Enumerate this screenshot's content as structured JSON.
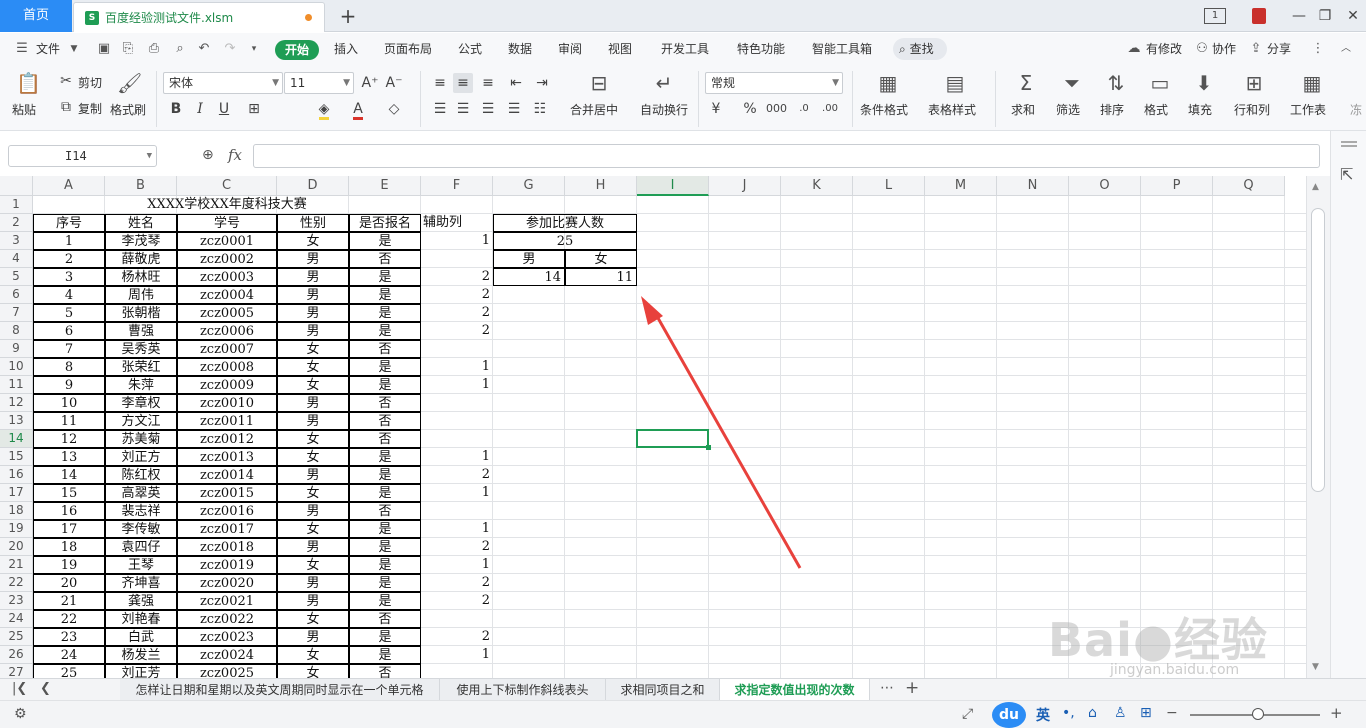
{
  "tabs": {
    "home": "首页",
    "file": "百度经验测试文件.xlsm",
    "new_tab": "+"
  },
  "window": {
    "badge": "1"
  },
  "menu": {
    "file": "文件",
    "items": [
      "开始",
      "插入",
      "页面布局",
      "公式",
      "数据",
      "审阅",
      "视图",
      "开发工具",
      "特色功能",
      "智能工具箱"
    ],
    "search": "查找",
    "right": [
      "有修改",
      "协作",
      "分享"
    ]
  },
  "ribbon": {
    "paste": "粘贴",
    "cut": "剪切",
    "copy": "复制",
    "format_painter": "格式刷",
    "font_name": "宋体",
    "font_size": "11",
    "merge_center": "合并居中",
    "wrap_text": "自动换行",
    "number_format": "常规",
    "conditional_format": "条件格式",
    "table_style": "表格样式",
    "sum": "求和",
    "filter": "筛选",
    "sort": "排序",
    "format": "格式",
    "fill": "填充",
    "rows_cols": "行和列",
    "worksheet": "工作表",
    "freeze": "冻"
  },
  "formula_bar": {
    "name_box": "I14",
    "fx": "fx",
    "value": ""
  },
  "sheet": {
    "columns": [
      "A",
      "B",
      "C",
      "D",
      "E",
      "F",
      "G",
      "H",
      "I",
      "J",
      "K",
      "L",
      "M",
      "N",
      "O",
      "P",
      "Q"
    ],
    "selected_col": "I",
    "selected_row": 14,
    "title": "XXXX学校XX年度科技大赛",
    "headers": [
      "序号",
      "姓名",
      "学号",
      "性别",
      "是否报名",
      "辅助列"
    ],
    "rows": [
      [
        "1",
        "李茂琴",
        "zcz0001",
        "女",
        "是",
        "1"
      ],
      [
        "2",
        "薛敬虎",
        "zcz0002",
        "男",
        "否",
        ""
      ],
      [
        "3",
        "杨林旺",
        "zcz0003",
        "男",
        "是",
        "2"
      ],
      [
        "4",
        "周伟",
        "zcz0004",
        "男",
        "是",
        "2"
      ],
      [
        "5",
        "张朝楷",
        "zcz0005",
        "男",
        "是",
        "2"
      ],
      [
        "6",
        "曹强",
        "zcz0006",
        "男",
        "是",
        "2"
      ],
      [
        "7",
        "吴秀英",
        "zcz0007",
        "女",
        "否",
        ""
      ],
      [
        "8",
        "张荣红",
        "zcz0008",
        "女",
        "是",
        "1"
      ],
      [
        "9",
        "朱萍",
        "zcz0009",
        "女",
        "是",
        "1"
      ],
      [
        "10",
        "李章权",
        "zcz0010",
        "男",
        "否",
        ""
      ],
      [
        "11",
        "方文江",
        "zcz0011",
        "男",
        "否",
        ""
      ],
      [
        "12",
        "苏美菊",
        "zcz0012",
        "女",
        "否",
        ""
      ],
      [
        "13",
        "刘正方",
        "zcz0013",
        "女",
        "是",
        "1"
      ],
      [
        "14",
        "陈红权",
        "zcz0014",
        "男",
        "是",
        "2"
      ],
      [
        "15",
        "高翠英",
        "zcz0015",
        "女",
        "是",
        "1"
      ],
      [
        "16",
        "裴志祥",
        "zcz0016",
        "男",
        "否",
        ""
      ],
      [
        "17",
        "李传敏",
        "zcz0017",
        "女",
        "是",
        "1"
      ],
      [
        "18",
        "袁四仔",
        "zcz0018",
        "男",
        "是",
        "2"
      ],
      [
        "19",
        "王琴",
        "zcz0019",
        "女",
        "是",
        "1"
      ],
      [
        "20",
        "齐坤喜",
        "zcz0020",
        "男",
        "是",
        "2"
      ],
      [
        "21",
        "龚强",
        "zcz0021",
        "男",
        "是",
        "2"
      ],
      [
        "22",
        "刘艳春",
        "zcz0022",
        "女",
        "否",
        ""
      ],
      [
        "23",
        "白武",
        "zcz0023",
        "男",
        "是",
        "2"
      ],
      [
        "24",
        "杨发兰",
        "zcz0024",
        "女",
        "是",
        "1"
      ],
      [
        "25",
        "刘正芳",
        "zcz0025",
        "女",
        "否",
        ""
      ]
    ],
    "summary": {
      "label": "参加比赛人数",
      "total": "25",
      "male_label": "男",
      "female_label": "女",
      "male_count": "14",
      "female_count": "11"
    }
  },
  "sheet_tabs": [
    "怎样让日期和星期以及英文周期同时显示在一个单元格",
    "使用上下标制作斜线表头",
    "求相同项目之和",
    "求指定数值出现的次数"
  ],
  "active_sheet": 3,
  "watermark": {
    "brand": "Bai",
    "brand_cn": "经验",
    "url": "jingyan.baidu.com"
  },
  "ime": {
    "lang": "英"
  },
  "colors": {
    "accent": "#1f9d55",
    "home_tab": "#2b8cf5",
    "arrow": "#e8413c"
  }
}
